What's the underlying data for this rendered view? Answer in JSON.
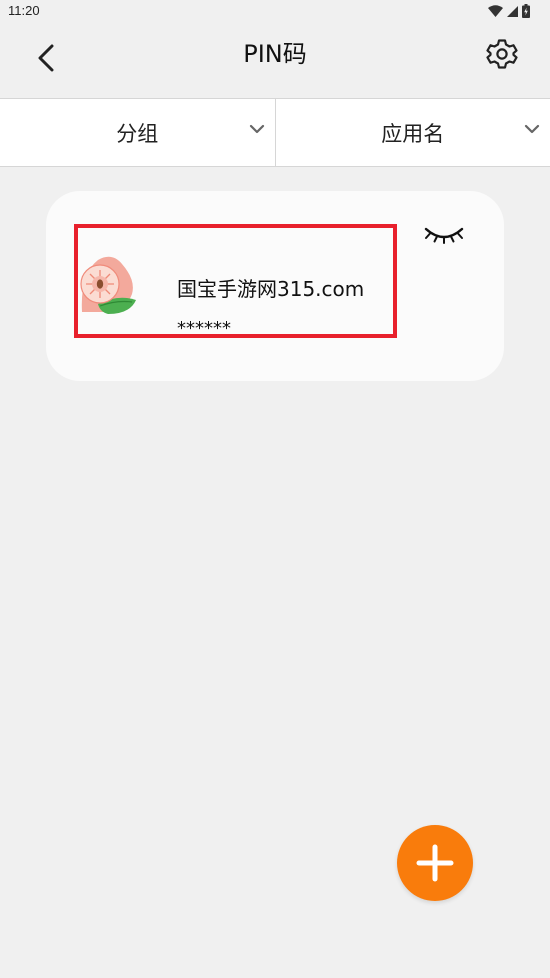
{
  "status_bar": {
    "time": "11:20"
  },
  "header": {
    "title": "PIN码",
    "back_icon": "chevron-left-icon",
    "settings_icon": "gear-icon"
  },
  "filters": [
    {
      "label": "分组",
      "icon": "chevron-down-icon"
    },
    {
      "label": "应用名",
      "icon": "chevron-down-icon"
    }
  ],
  "entries": [
    {
      "app_name": "国宝手游网315.com",
      "masked_pin": "******",
      "icon": "peach-icon",
      "visibility_icon": "eye-closed-icon"
    }
  ],
  "fab": {
    "icon": "plus-icon",
    "color": "#f97c0c"
  },
  "colors": {
    "background": "#f0f0f0",
    "card": "#fbfbfb",
    "highlight": "#e8202c",
    "accent": "#f97c0c"
  }
}
